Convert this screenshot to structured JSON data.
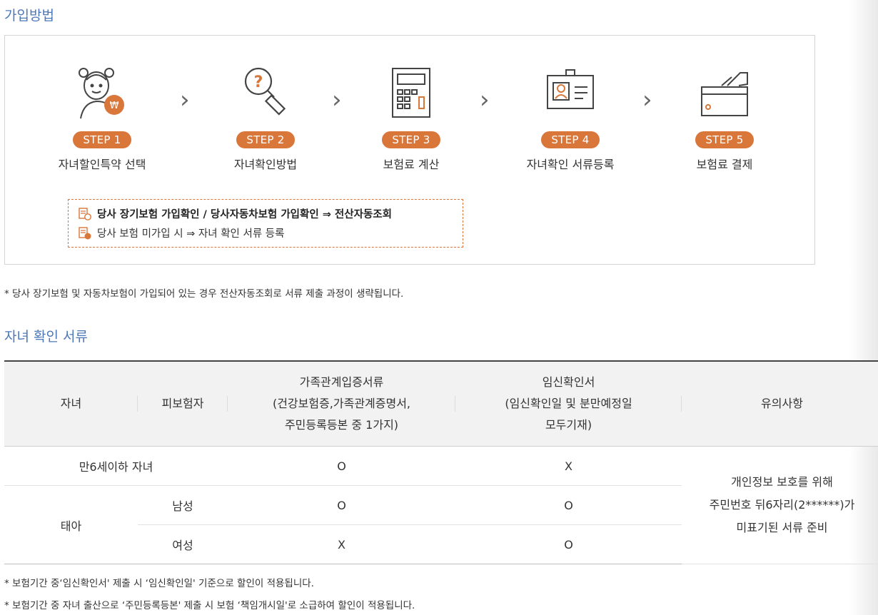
{
  "section1": {
    "title": "가입방법"
  },
  "steps": [
    {
      "badge": "STEP 1",
      "label": "자녀할인특약 선택",
      "icon": "child-discount-icon"
    },
    {
      "badge": "STEP 2",
      "label": "자녀확인방법",
      "icon": "magnifier-question-icon"
    },
    {
      "badge": "STEP 3",
      "label": "보험료 계산",
      "icon": "calculator-icon"
    },
    {
      "badge": "STEP 4",
      "label": "자녀확인 서류등록",
      "icon": "id-card-icon"
    },
    {
      "badge": "STEP 5",
      "label": "보험료 결제",
      "icon": "card-payment-icon"
    }
  ],
  "callout": {
    "line1": "당사 장기보험 가입확인 / 당사자동차보험 가입확인 ⇒ 전산자동조회",
    "line2": "당사 보험 미가입 시 ⇒ 자녀 확인 서류 등록"
  },
  "note1": "* 당사 장기보험 및 자동차보험이 가입되어 있는 경우 전산자동조회로 서류 제출 과정이 생략됩니다.",
  "section2": {
    "title": "자녀 확인 서류"
  },
  "table": {
    "headers": {
      "child": "자녀",
      "insured": "피보험자",
      "family_l1": "가족관계입증서류",
      "family_l2": "(건강보험증,가족관계증명서,",
      "family_l3": "주민등록등본 중 1가지)",
      "preg_l1": "임신확인서",
      "preg_l2": "(임신확인일 및 분만예정일",
      "preg_l3": "모두기재)",
      "notes": "유의사항"
    },
    "rows": {
      "under6": {
        "child": "만6세이하 자녀",
        "family": "O",
        "preg": "X"
      },
      "fetus_label": "태아",
      "male": {
        "insured": "남성",
        "family": "O",
        "preg": "O"
      },
      "female": {
        "insured": "여성",
        "family": "X",
        "preg": "O"
      }
    },
    "caution_l1": "개인정보 보호를 위해",
    "caution_l2": "주민번호 뒤6자리(2******)가",
    "caution_l3": "미표기된 서류 준비"
  },
  "note2": "* 보험기간 중‘임신확인서' 제출 시 ‘임신확인일' 기준으로 할인이 적용됩니다.",
  "note3": "* 보험기간 중 자녀 출산으로 ‘주민등록등본' 제출 시 보험 ‘책임개시일'로 소급하여 할인이 적용됩니다.",
  "colors": {
    "accent_orange": "#d9763a",
    "title_blue": "#4d78b8"
  }
}
